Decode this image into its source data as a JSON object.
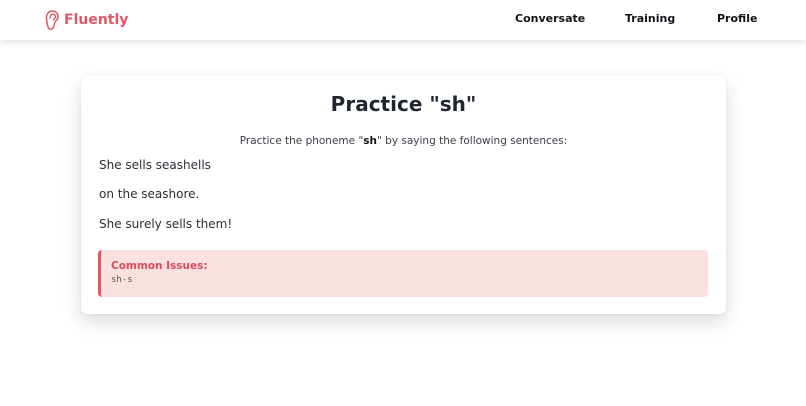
{
  "nav": {
    "brand": "Fluently",
    "links": [
      "Conversate",
      "Training",
      "Profile"
    ]
  },
  "practice": {
    "title": "Practice \"sh\"",
    "instruction_prefix": "Practice the phoneme \"",
    "phoneme": "sh",
    "instruction_suffix": "\" by saying the following sentences:",
    "sentences": [
      "She sells seashells",
      "on the seashore.",
      "She surely sells them!"
    ]
  },
  "issues": {
    "title": "Common Issues:",
    "items": [
      "sh-s"
    ]
  },
  "colors": {
    "brand": "#e05764",
    "issues_bg": "#fbe0e0"
  },
  "icons": {
    "logo": "ear-icon"
  }
}
